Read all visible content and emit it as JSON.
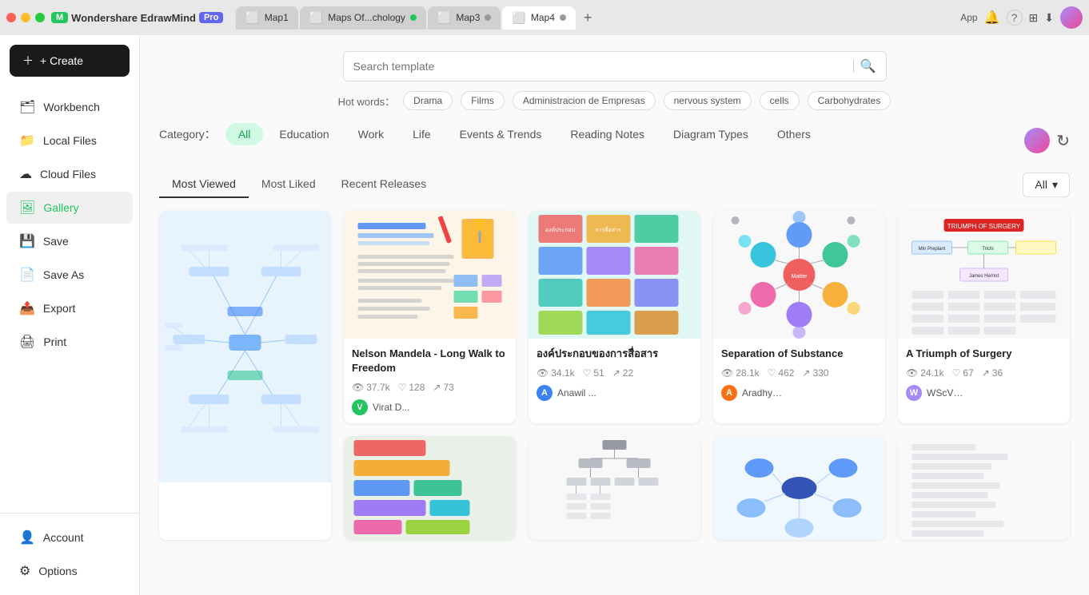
{
  "titlebar": {
    "app_name": "Wondershare EdrawMind",
    "badge": "Pro",
    "tabs": [
      {
        "id": "tab1",
        "label": "Map1",
        "active": false,
        "has_dot": false,
        "dot_color": ""
      },
      {
        "id": "tab2",
        "label": "Maps Of...chology",
        "active": false,
        "has_dot": true,
        "dot_color": "green"
      },
      {
        "id": "tab3",
        "label": "Map3",
        "active": false,
        "has_dot": true,
        "dot_color": "gray"
      },
      {
        "id": "tab4",
        "label": "Map4",
        "active": false,
        "has_dot": true,
        "dot_color": "gray"
      }
    ],
    "new_tab_label": "+"
  },
  "toolbar": {
    "app_label": "App",
    "bell_label": "🔔",
    "help_label": "?",
    "grid_label": "⊞"
  },
  "sidebar": {
    "create_label": "+ Create",
    "items": [
      {
        "id": "workbench",
        "label": "Workbench",
        "icon": "🗂"
      },
      {
        "id": "local-files",
        "label": "Local Files",
        "icon": "📁"
      },
      {
        "id": "cloud-files",
        "label": "Cloud Files",
        "icon": "☁"
      },
      {
        "id": "gallery",
        "label": "Gallery",
        "icon": "🖼",
        "active": true
      },
      {
        "id": "save",
        "label": "Save",
        "icon": "💾"
      },
      {
        "id": "save-as",
        "label": "Save As",
        "icon": "📄"
      },
      {
        "id": "export",
        "label": "Export",
        "icon": "📤"
      },
      {
        "id": "print",
        "label": "Print",
        "icon": "🖨"
      }
    ],
    "bottom_items": [
      {
        "id": "account",
        "label": "Account",
        "icon": "👤"
      },
      {
        "id": "options",
        "label": "Options",
        "icon": "⚙"
      }
    ]
  },
  "search": {
    "placeholder": "Search template",
    "hot_words_label": "Hot words：",
    "hot_tags": [
      "Drama",
      "Films",
      "Administracion de Empresas",
      "nervous system",
      "cells",
      "Carbohydrates"
    ]
  },
  "categories": {
    "label": "Category：",
    "items": [
      "All",
      "Education",
      "Work",
      "Life",
      "Events & Trends",
      "Reading Notes",
      "Diagram Types",
      "Others"
    ],
    "active": "All"
  },
  "sort": {
    "tabs": [
      "Most Viewed",
      "Most Liked",
      "Recent Releases"
    ],
    "active": "Most Viewed",
    "filter_label": "All",
    "filter_arrow": "▾"
  },
  "cards": [
    {
      "id": "card1",
      "title": "",
      "thumb_type": "mindmap-blue",
      "stats": [],
      "author_avatar_bg": "",
      "author_name": ""
    },
    {
      "id": "card2",
      "title": "Nelson Mandela - Long Walk to Freedom",
      "thumb_type": "beige",
      "views": "37.7k",
      "likes": "128",
      "shares": "73",
      "author_avatar_bg": "#22c55e",
      "author_initial": "V",
      "author_name": "Virat D..."
    },
    {
      "id": "card3",
      "title": "องค์ประกอบของการสื่อสาร",
      "thumb_type": "teal",
      "views": "34.1k",
      "likes": "51",
      "shares": "22",
      "author_avatar_bg": "#3b82f6",
      "author_initial": "A",
      "author_name": "Anawil ..."
    },
    {
      "id": "card4",
      "title": "Separation of Substance",
      "thumb_type": "white-circles",
      "views": "28.1k",
      "likes": "462",
      "shares": "330",
      "author_avatar_bg": "#f97316",
      "author_initial": "A",
      "author_name": "Aradhy…"
    },
    {
      "id": "card5",
      "title": "A Triumph of Surgery",
      "thumb_type": "white-flowchart",
      "views": "24.1k",
      "likes": "67",
      "shares": "36",
      "author_avatar_bg": "#a78bfa",
      "author_initial": "W",
      "author_name": "WScV…"
    }
  ],
  "second_row_cards": [
    {
      "id": "card6",
      "title": "",
      "thumb_type": "colorful-bars",
      "views": "",
      "likes": "",
      "shares": "",
      "author_name": ""
    },
    {
      "id": "card7",
      "title": "",
      "thumb_type": "gray-tree",
      "views": "",
      "likes": "",
      "shares": "",
      "author_name": ""
    },
    {
      "id": "card8",
      "title": "",
      "thumb_type": "blue-nodes",
      "views": "",
      "likes": "",
      "shares": "",
      "author_name": ""
    },
    {
      "id": "card9",
      "title": "",
      "thumb_type": "light-gray",
      "views": "",
      "likes": "",
      "shares": "",
      "author_name": ""
    }
  ]
}
